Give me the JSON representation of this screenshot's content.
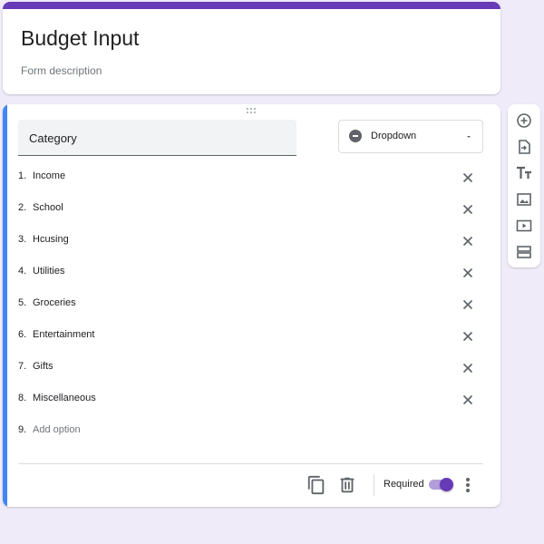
{
  "form": {
    "title": "Budget Input",
    "description_placeholder": "Form description",
    "accent_color": "#673ab7",
    "active_question_color": "#4285f4"
  },
  "question": {
    "title": "Category",
    "type": "Dropdown",
    "options": [
      {
        "number": "1.",
        "label": "Income"
      },
      {
        "number": "2.",
        "label": "School"
      },
      {
        "number": "3.",
        "label": "Hcusing"
      },
      {
        "number": "4.",
        "label": "Utilities"
      },
      {
        "number": "5.",
        "label": "Groceries"
      },
      {
        "number": "6.",
        "label": "Entertainment"
      },
      {
        "number": "7.",
        "label": "Gifts"
      },
      {
        "number": "8.",
        "label": "Miscellaneous"
      }
    ],
    "add_option": {
      "number": "9.",
      "label": "Add option"
    },
    "required_label": "Required",
    "required": true
  },
  "icons": {
    "question_card": [
      "drag-handle-icon",
      "dropdown-type-icon",
      "chevron-down-icon",
      "close-icon",
      "copy-icon",
      "trash-icon",
      "more-vert-icon"
    ],
    "side_toolbar": [
      "add-question-icon",
      "import-questions-icon",
      "add-title-icon",
      "add-image-icon",
      "add-video-icon",
      "add-section-icon"
    ]
  }
}
